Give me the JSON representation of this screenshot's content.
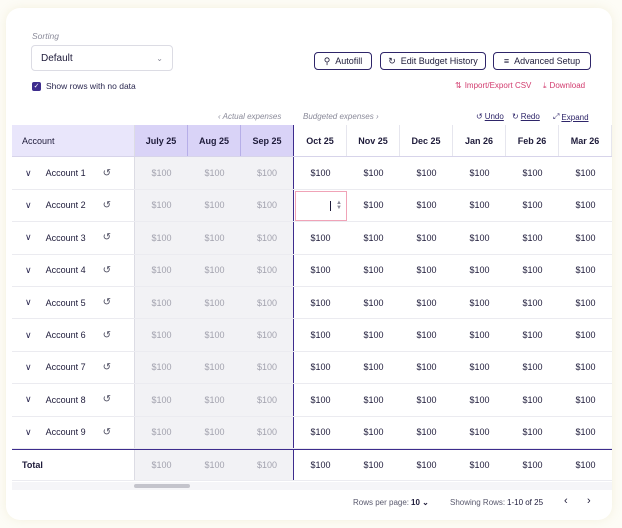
{
  "sorting": {
    "label": "Sorting",
    "value": "Default"
  },
  "show_empty": {
    "label": "Show rows with no data",
    "checked": true
  },
  "buttons": {
    "autofill": "Autofill",
    "history": "Edit Budget History",
    "setup": "Advanced Setup"
  },
  "links": {
    "import_export": "Import/Export CSV",
    "download": "Download"
  },
  "nav": {
    "actual": "Actual expenses",
    "budgeted": "Budgeted expenses"
  },
  "tools": {
    "undo": "Undo",
    "redo": "Redo",
    "expand": "Expand"
  },
  "columns": {
    "account": "Account",
    "months": [
      "July 25",
      "Aug 25",
      "Sep 25",
      "Oct 25",
      "Nov 25",
      "Dec 25",
      "Jan 26",
      "Feb 26",
      "Mar 26"
    ],
    "actual_count": 3
  },
  "rows": [
    {
      "name": "Account 1",
      "values": [
        "$100",
        "$100",
        "$100",
        "$100",
        "$100",
        "$100",
        "$100",
        "$100",
        "$100"
      ]
    },
    {
      "name": "Account 2",
      "values": [
        "$100",
        "$100",
        "$100",
        "",
        "$100",
        "$100",
        "$100",
        "$100",
        "$100"
      ],
      "editing_col": 3
    },
    {
      "name": "Account 3",
      "values": [
        "$100",
        "$100",
        "$100",
        "$100",
        "$100",
        "$100",
        "$100",
        "$100",
        "$100"
      ]
    },
    {
      "name": "Account 4",
      "values": [
        "$100",
        "$100",
        "$100",
        "$100",
        "$100",
        "$100",
        "$100",
        "$100",
        "$100"
      ]
    },
    {
      "name": "Account 5",
      "values": [
        "$100",
        "$100",
        "$100",
        "$100",
        "$100",
        "$100",
        "$100",
        "$100",
        "$100"
      ]
    },
    {
      "name": "Account 6",
      "values": [
        "$100",
        "$100",
        "$100",
        "$100",
        "$100",
        "$100",
        "$100",
        "$100",
        "$100"
      ]
    },
    {
      "name": "Account 7",
      "values": [
        "$100",
        "$100",
        "$100",
        "$100",
        "$100",
        "$100",
        "$100",
        "$100",
        "$100"
      ]
    },
    {
      "name": "Account 8",
      "values": [
        "$100",
        "$100",
        "$100",
        "$100",
        "$100",
        "$100",
        "$100",
        "$100",
        "$100"
      ]
    },
    {
      "name": "Account 9",
      "values": [
        "$100",
        "$100",
        "$100",
        "$100",
        "$100",
        "$100",
        "$100",
        "$100",
        "$100"
      ]
    }
  ],
  "total": {
    "label": "Total",
    "values": [
      "$100",
      "$100",
      "$100",
      "$100",
      "$100",
      "$100",
      "$100",
      "$100",
      "$100"
    ]
  },
  "footer": {
    "rows_per_page_label": "Rows per page:",
    "rows_per_page": "10",
    "showing_label": "Showing Rows:",
    "showing_value": "1-10 of 25"
  },
  "colors": {
    "accent": "#3d2c8d",
    "actual_header": "#d9d3f7",
    "link": "#d23b6e"
  }
}
